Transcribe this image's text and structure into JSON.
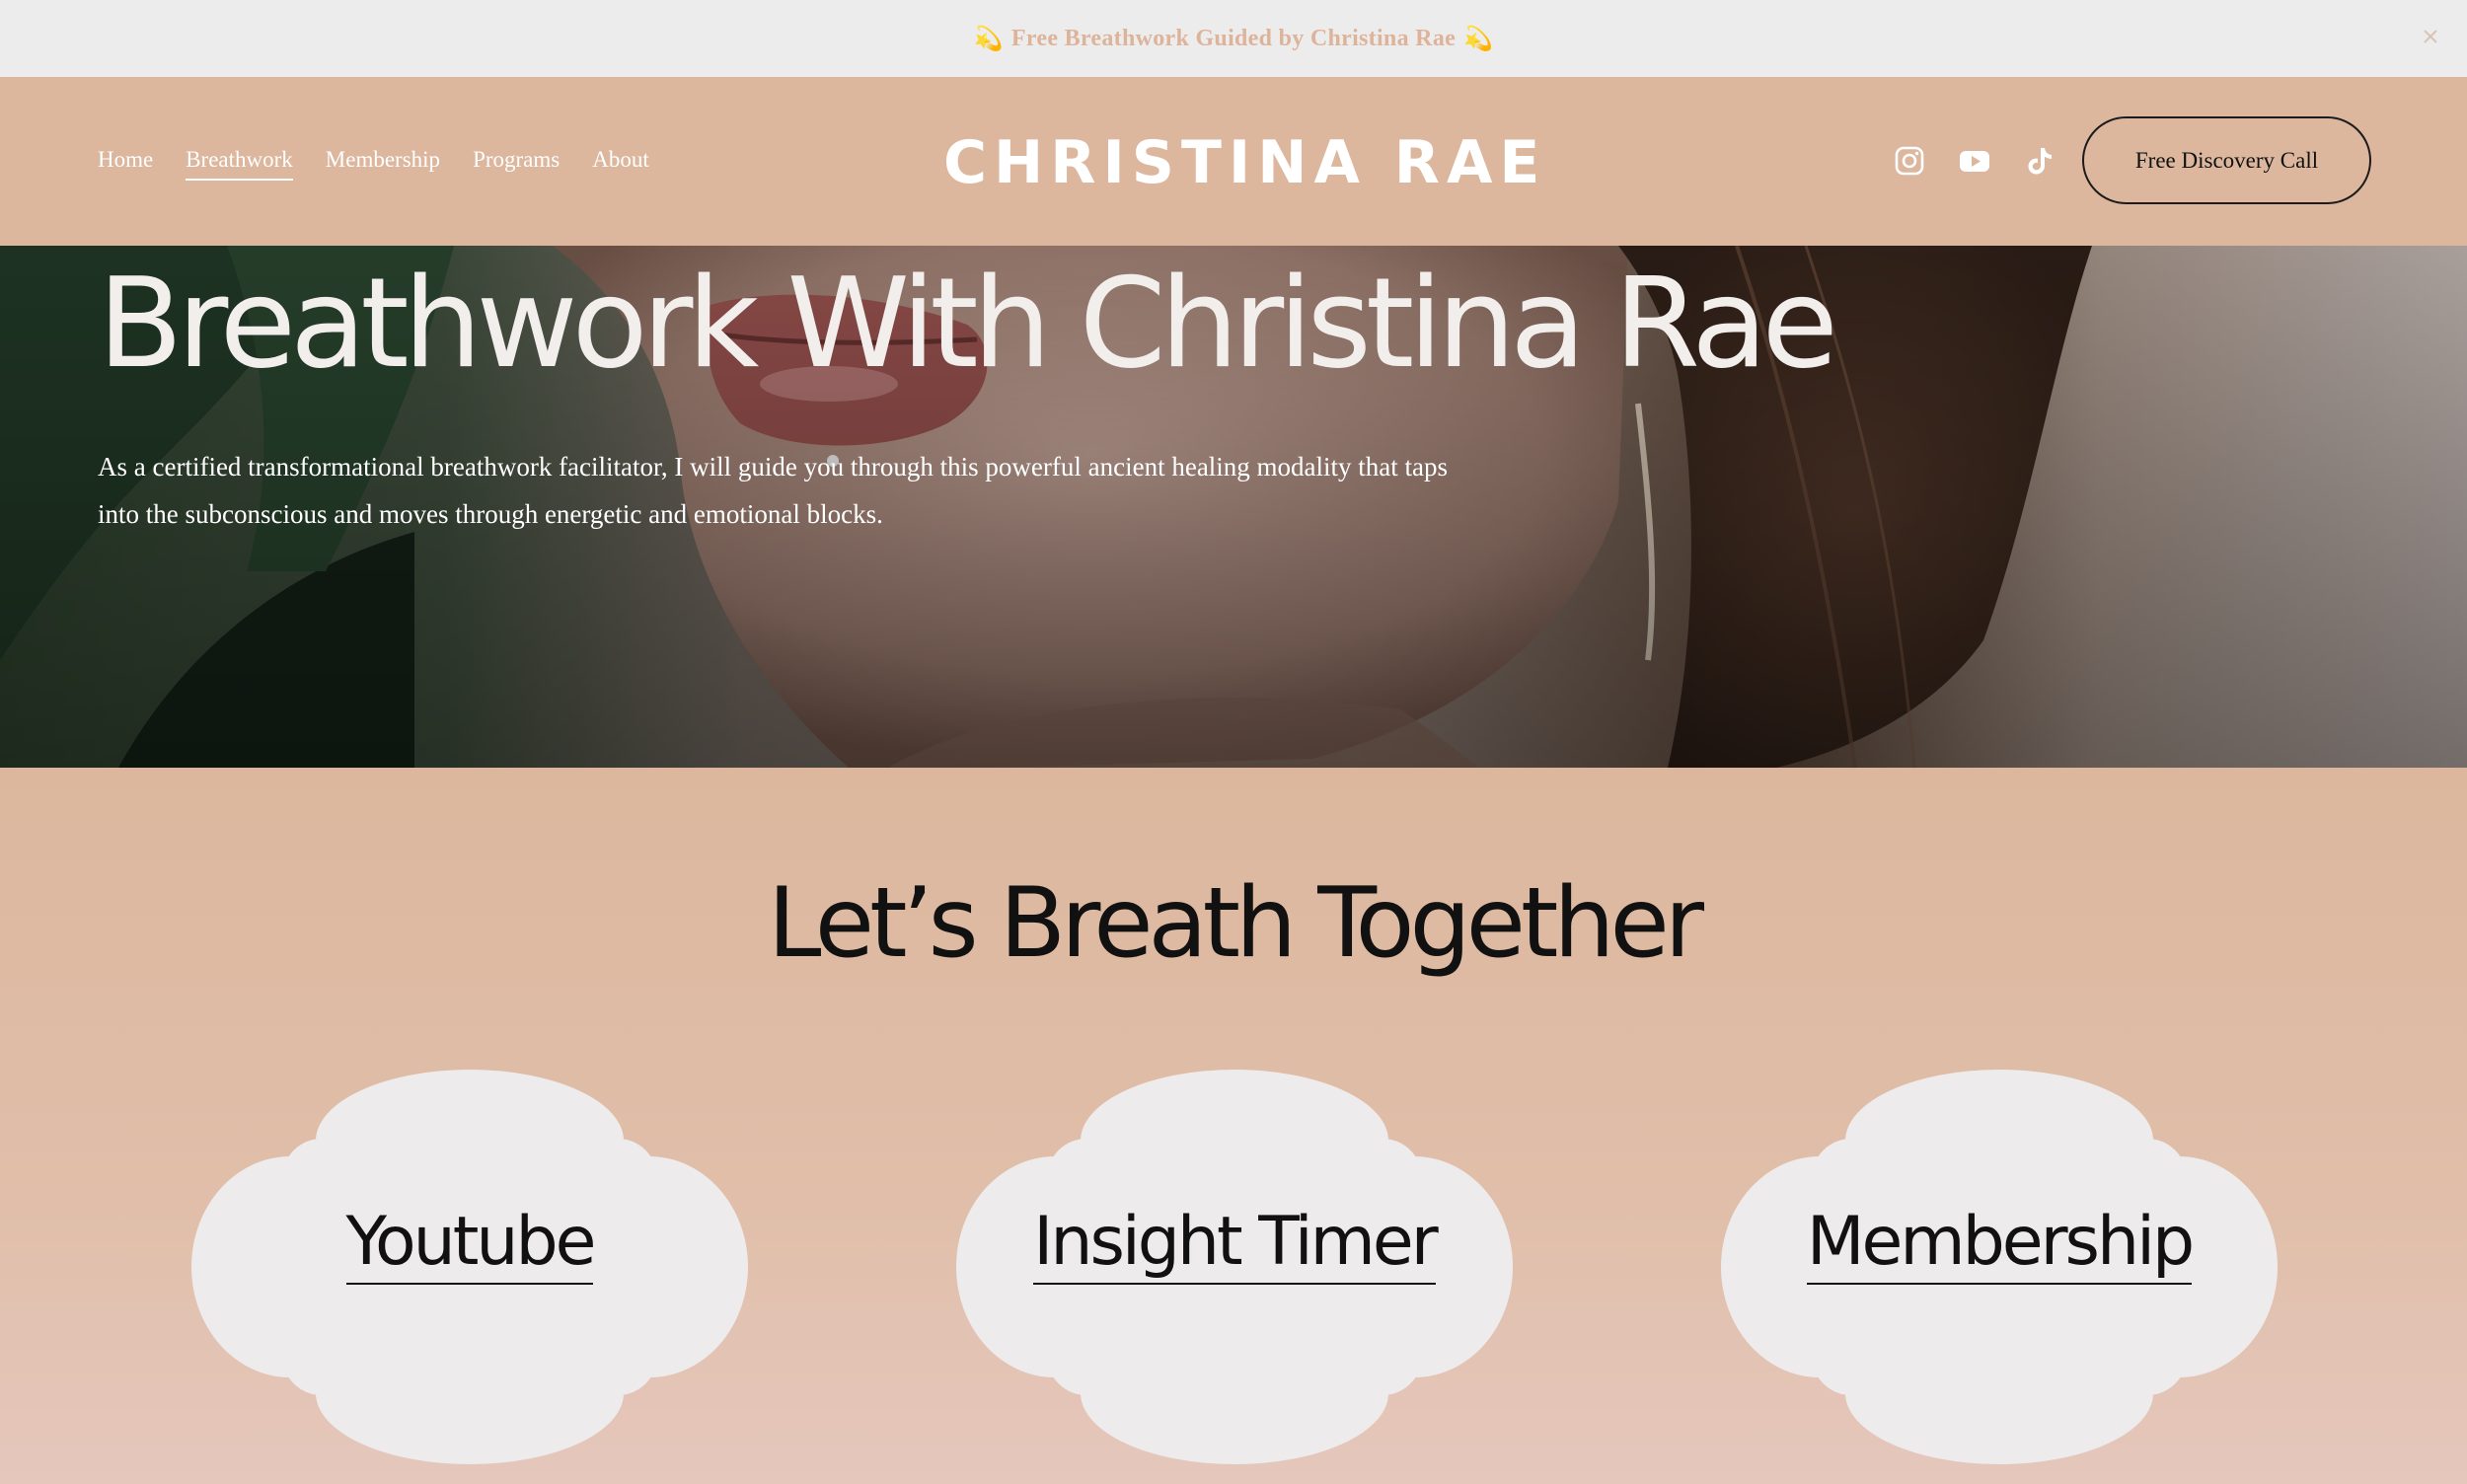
{
  "announcement": {
    "text": "Free Breathwork Guided by Christina Rae",
    "glyph_left": "💫",
    "glyph_right": "💫",
    "close_icon": "close-icon"
  },
  "header": {
    "nav": [
      {
        "label": "Home",
        "active": false
      },
      {
        "label": "Breathwork",
        "active": true
      },
      {
        "label": "Membership",
        "active": false
      },
      {
        "label": "Programs",
        "active": false
      },
      {
        "label": "About",
        "active": false
      }
    ],
    "logo": "CHRISTINA RAE",
    "social": [
      "instagram-icon",
      "youtube-icon",
      "tiktok-icon"
    ],
    "cta_label": "Free Discovery Call"
  },
  "hero": {
    "title": "Breathwork With Christina Rae",
    "text": "As a certified transformational breathwork facilitator, I will guide you through this powerful ancient healing modality that taps into the subconscious and moves through energetic and emotional blocks."
  },
  "breath": {
    "title": "Let’s Breath Together",
    "cards": [
      {
        "label": "Youtube"
      },
      {
        "label": "Insight Timer"
      },
      {
        "label": "Membership"
      }
    ]
  },
  "colors": {
    "announcement_bg": "#edeced",
    "announcement_text": "#ddb39a",
    "header_bg": "#dcb79e",
    "section_gradient_top": "#dcb79e",
    "section_gradient_bottom": "#e5c7bc",
    "card_fill": "#edebec",
    "ink": "#111111"
  }
}
